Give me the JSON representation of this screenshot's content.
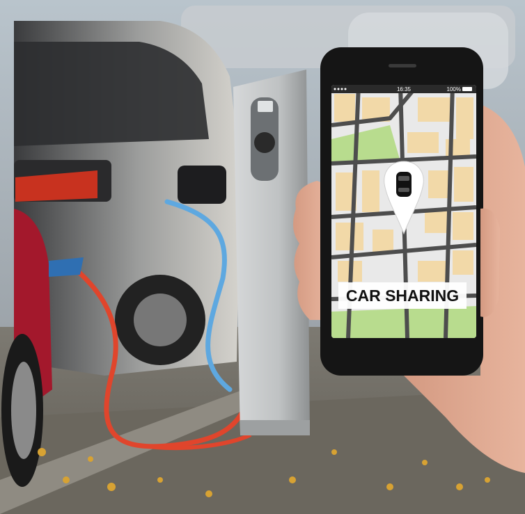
{
  "phone": {
    "status_time": "16:35",
    "status_battery": "100%",
    "banner_text": "CAR SHARING"
  },
  "colors": {
    "map_roads": "#4d4d4d",
    "map_blocks": "#f2d9a8",
    "map_park": "#b8dc8e",
    "map_background": "#e9e9e9",
    "cable_red": "#e0452c",
    "cable_blue": "#5ea8e0",
    "charger_body": "#c9cbcc"
  },
  "icons": {
    "map_pin": "car-location-pin-icon"
  }
}
